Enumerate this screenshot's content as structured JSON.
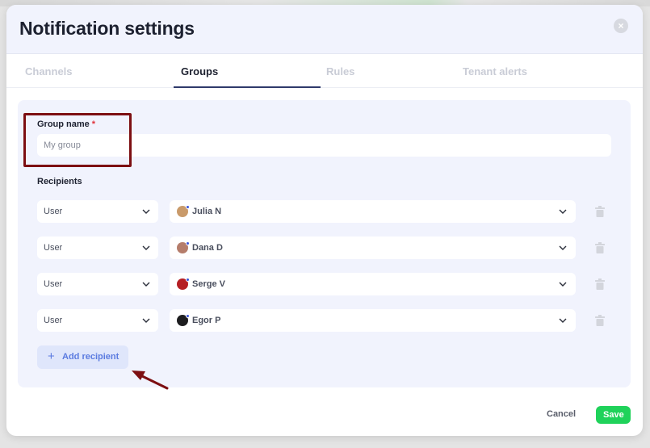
{
  "modal": {
    "title": "Notification settings",
    "close_symbol": "×"
  },
  "tabs": [
    {
      "label": "Channels",
      "active": false
    },
    {
      "label": "Groups",
      "active": true
    },
    {
      "label": "Rules",
      "active": false
    },
    {
      "label": "Tenant alerts",
      "active": false
    }
  ],
  "form": {
    "group_name_label": "Group name",
    "required_mark": "*",
    "group_name_value": "",
    "group_name_placeholder": "My group",
    "recipients_label": "Recipients"
  },
  "recipients": [
    {
      "type": "User",
      "name": "Julia N",
      "avatar_color": "#c99a6a"
    },
    {
      "type": "User",
      "name": "Dana D",
      "avatar_color": "#b57d6b"
    },
    {
      "type": "User",
      "name": "Serge V",
      "avatar_color": "#b51f24"
    },
    {
      "type": "User",
      "name": "Egor P",
      "avatar_color": "#1d1d1f"
    }
  ],
  "actions": {
    "add_recipient_label": "Add recipient",
    "add_icon": "+",
    "cancel_label": "Cancel",
    "save_label": "Save"
  },
  "icons": {
    "close": "close-icon",
    "chevron": "chevron-down-icon",
    "trash": "trash-icon",
    "plus": "plus-icon"
  },
  "colors": {
    "accent": "#5b7be0",
    "save": "#1fd25a",
    "annotation": "#7d0f12",
    "tab_underline": "#2f3a6b"
  }
}
